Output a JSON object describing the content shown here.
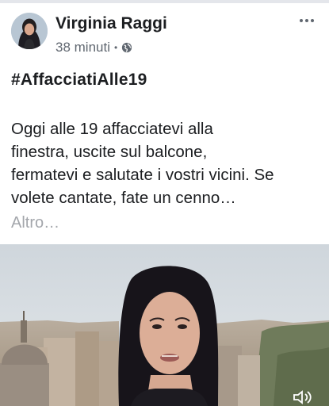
{
  "post": {
    "author": "Virginia Raggi",
    "timestamp": "38 minuti",
    "separator": "•",
    "privacy_icon": "globe-icon",
    "more_icon": "more-horizontal-icon",
    "hashtag": "#AffacciatiAlle19",
    "text_lines": [
      "Oggi alle 19 affacciatevi alla",
      "finestra, uscite sul balcone,",
      "fermatevi e salutate i vostri vicini. Se",
      "volete cantate, fate un cenno…"
    ],
    "see_more": "Altro…"
  },
  "video": {
    "sound_icon": "speaker-icon"
  },
  "colors": {
    "text_primary": "#1c1e21",
    "text_secondary": "#606770",
    "see_more": "#a3a6ab"
  }
}
